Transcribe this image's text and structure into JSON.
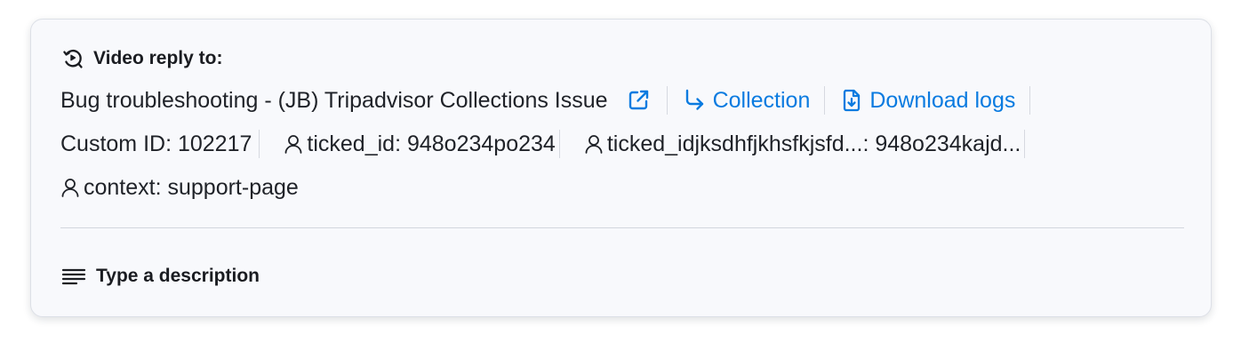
{
  "reply": {
    "header_label": "Video reply to:",
    "title": "Bug troubleshooting - (JB) Tripadvisor Collections Issue",
    "collection_label": "Collection",
    "download_label": "Download logs"
  },
  "metadata": {
    "custom_id": "Custom ID: 102217",
    "items": [
      {
        "label": "ticked_id: 948o234po234",
        "icon": "user-icon"
      },
      {
        "label": "ticked_idjksdhfjkhsfkjsfd...: 948o234kajd...",
        "icon": "user-icon"
      },
      {
        "label": "context: support-page",
        "icon": "user-icon"
      }
    ]
  },
  "description": {
    "placeholder": "Type a description"
  },
  "colors": {
    "link": "#0a7be0",
    "text": "#1f2228",
    "card_background": "#f8f9fc"
  },
  "icons": [
    "video-reply-icon",
    "external-link-icon",
    "arrow-down-right-icon",
    "download-file-icon",
    "user-icon",
    "text-lines-icon"
  ]
}
